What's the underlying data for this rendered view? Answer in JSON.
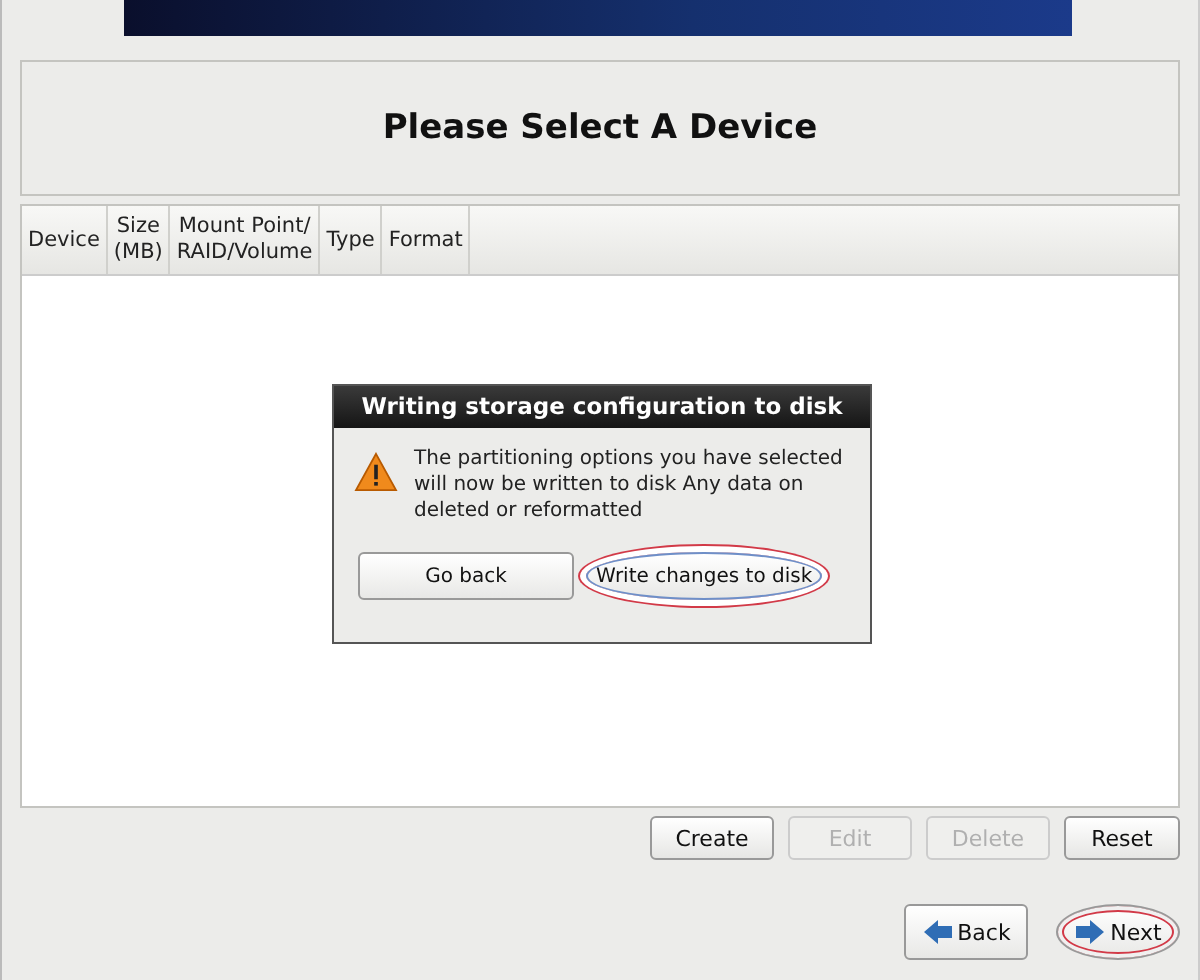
{
  "header": {
    "title": "Please Select A Device"
  },
  "table": {
    "columns": [
      {
        "lines": [
          "Device"
        ]
      },
      {
        "lines": [
          "Size",
          "(MB)"
        ]
      },
      {
        "lines": [
          "Mount Point/",
          "RAID/Volume"
        ]
      },
      {
        "lines": [
          "Type"
        ]
      },
      {
        "lines": [
          "Format"
        ]
      }
    ]
  },
  "dialog": {
    "title": "Writing storage configuration to disk",
    "message": "The partitioning options you have selected will now be written to disk  Any data on deleted or reformatted",
    "buttons": [
      {
        "label": "Go back",
        "focused": false,
        "highlighted": false
      },
      {
        "label": "Write changes to disk",
        "focused": true,
        "highlighted": true
      }
    ]
  },
  "actions": [
    {
      "label": "Create",
      "disabled": false
    },
    {
      "label": "Edit",
      "disabled": true
    },
    {
      "label": "Delete",
      "disabled": true
    },
    {
      "label": "Reset",
      "disabled": false
    }
  ],
  "nav": [
    {
      "label": "Back",
      "kind": "back",
      "highlighted": false
    },
    {
      "label": "Next",
      "kind": "next",
      "highlighted": true
    }
  ]
}
